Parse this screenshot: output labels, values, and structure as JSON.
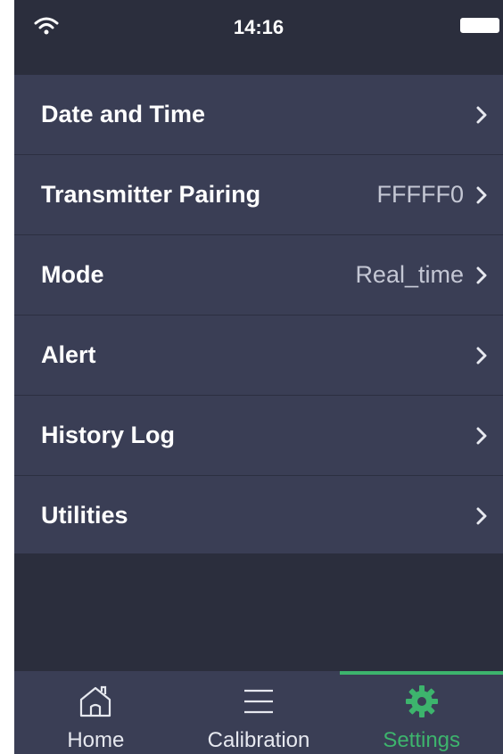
{
  "status_bar": {
    "time": "14:16",
    "wifi_icon": "wifi-icon",
    "battery_icon": "battery-icon"
  },
  "menu": {
    "items": [
      {
        "label": "Date and Time",
        "value": ""
      },
      {
        "label": "Transmitter Pairing",
        "value": "FFFFF0"
      },
      {
        "label": "Mode",
        "value": "Real_time"
      },
      {
        "label": "Alert",
        "value": ""
      },
      {
        "label": "History Log",
        "value": ""
      },
      {
        "label": "Utilities",
        "value": ""
      }
    ],
    "chevron_icon": "chevron-right-icon"
  },
  "tabbar": {
    "tabs": [
      {
        "label": "Home",
        "icon": "home-icon",
        "active": false
      },
      {
        "label": "Calibration",
        "icon": "list-icon",
        "active": false
      },
      {
        "label": "Settings",
        "icon": "gear-icon",
        "active": true
      }
    ]
  },
  "colors": {
    "background": "#2b2e3d",
    "menu_background": "#3a3e55",
    "accent": "#3db46d",
    "text": "#ffffff",
    "secondary_text": "#c4c7d4"
  }
}
